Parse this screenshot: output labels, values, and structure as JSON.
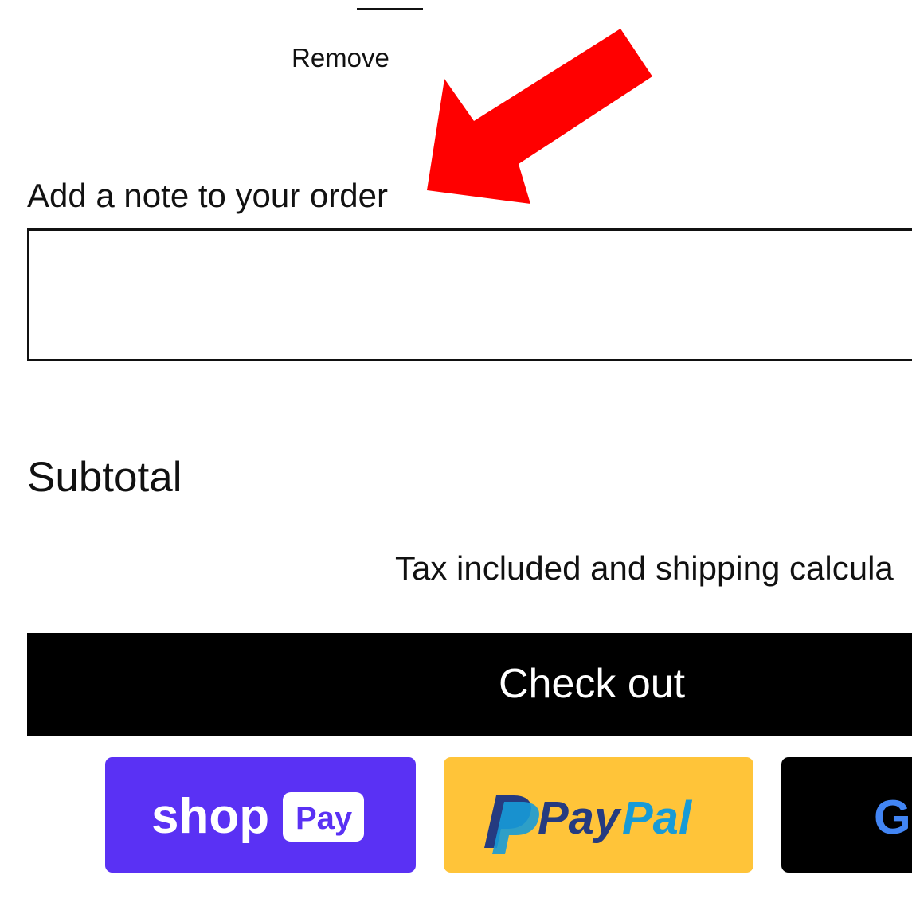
{
  "cart": {
    "remove_label": "Remove"
  },
  "note": {
    "label": "Add a note to your order",
    "value": "",
    "placeholder": ""
  },
  "summary": {
    "subtotal_label": "Subtotal",
    "tax_note": "Tax included and shipping calcula"
  },
  "checkout": {
    "button_label": "Check out"
  },
  "payment_options": [
    {
      "name": "Shop Pay",
      "brand_text": "shop",
      "badge_text": "Pay",
      "background": "#5a31f4",
      "icon": "shop-pay-logo"
    },
    {
      "name": "PayPal",
      "brand_text_1": "Pay",
      "brand_text_2": "Pal",
      "background": "#ffc439",
      "icon": "paypal-logo"
    },
    {
      "name": "Google Pay",
      "brand_text": "G",
      "background": "#000000",
      "icon": "google-g-logo"
    }
  ],
  "annotation": {
    "arrow_color": "#ff0000",
    "icon": "red-arrow"
  },
  "colors": {
    "text": "#111111",
    "checkout_background": "#000000",
    "checkout_text": "#ffffff",
    "paypal_dark_blue": "#253b80",
    "paypal_light_blue": "#179bd7"
  }
}
